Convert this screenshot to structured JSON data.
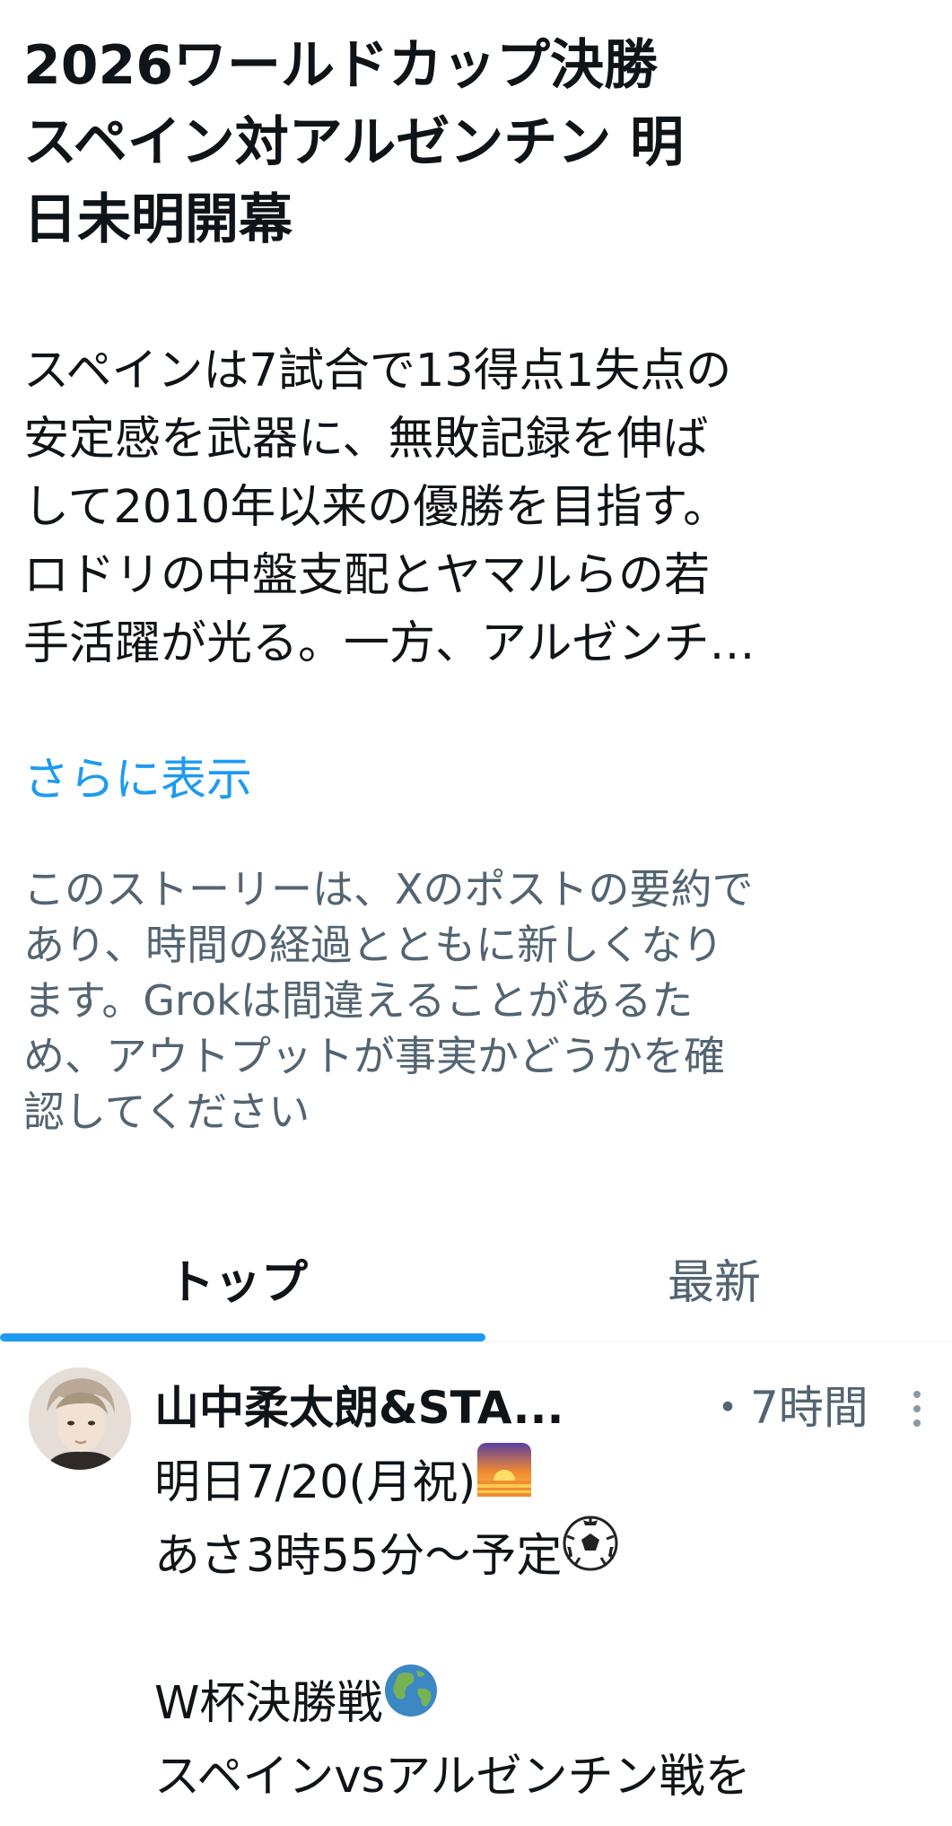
{
  "story": {
    "title": "2026ワールドカップ決勝スペイン対アルゼンチン 明日未明開幕",
    "title_lines": [
      "2026ワールドカップ決勝",
      "スペイン対アルゼンチン 明",
      "日未明開幕"
    ],
    "summary_lines": [
      "スペインは7試合で13得点1失点の",
      "安定感を武器に、無敗記録を伸ば",
      "して2010年以来の優勝を目指す。",
      "ロドリの中盤支配とヤマルらの若",
      "手活躍が光る。一方、アルゼンチ…"
    ],
    "show_more_label": "さらに表示",
    "disclaimer_lines": [
      "このストーリーは、Xのポストの要約で",
      "あり、時間の経過とともに新しくなり",
      "ます。Grokは間違えることがあるた",
      "め、アウトプットが事実かどうかを確",
      "認してください"
    ]
  },
  "tabs": {
    "items": [
      {
        "label": "トップ",
        "active": true
      },
      {
        "label": "最新",
        "active": false
      }
    ]
  },
  "post": {
    "author": "山中柔太朗&STA...",
    "time": "・7時間",
    "lines": [
      {
        "text": "明日7/20(月祝)",
        "emoji": "sunrise-icon"
      },
      {
        "text": "あさ3時55分〜予定",
        "emoji": "soccer-ball-icon"
      },
      {
        "text": "",
        "emoji": ""
      },
      {
        "text": "W杯決勝戦",
        "emoji": "globe-icon"
      },
      {
        "text": "スペインvsアルゼンチン戦を",
        "emoji": ""
      }
    ]
  },
  "colors": {
    "accent": "#1d9bf0",
    "text_primary": "#0f1419",
    "text_secondary": "#536471"
  }
}
